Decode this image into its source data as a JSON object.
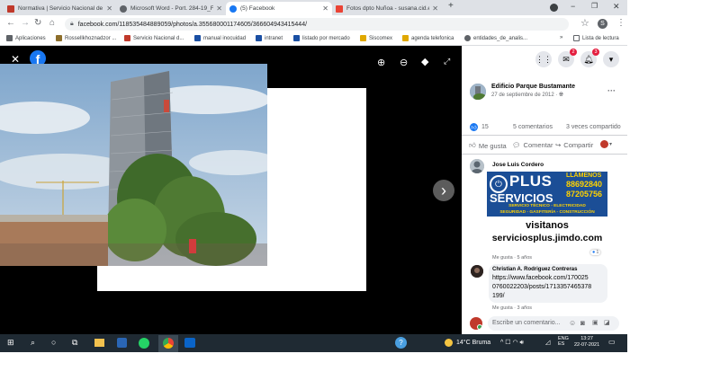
{
  "tabs": [
    {
      "title": "Normativa | Servicio Nacional de",
      "color": "#c0392b"
    },
    {
      "title": "Microsoft Word - Port. 284-19_F",
      "color": "#5f6368"
    },
    {
      "title": "(5) Facebook",
      "color": "#1877f2"
    },
    {
      "title": "Fotos dpto Ñuñoa - susana.cid.e",
      "color": "#ea4335"
    }
  ],
  "new_tab": "+",
  "window_controls": {
    "minimize": "−",
    "maximize": "❐",
    "close": "✕"
  },
  "address": {
    "url": "facebook.com/118535484889059/photos/a.355680001174605/366604943415444/"
  },
  "profile_initial": "S",
  "bookmarks": [
    {
      "label": "Aplicaciones",
      "color": "#5f6368"
    },
    {
      "label": "Rossellkhoznadzor ...",
      "color": "#8d6e2b"
    },
    {
      "label": "Servicio Nacional d...",
      "color": "#c0392b"
    },
    {
      "label": "manual inocuidad",
      "color": "#1a4fa3"
    },
    {
      "label": "intranet",
      "color": "#1a4fa3"
    },
    {
      "label": "listado por mercado",
      "color": "#1a4fa3"
    },
    {
      "label": "Siscomex",
      "color": "#e0a800"
    },
    {
      "label": "agenda telefonica",
      "color": "#e0a800"
    },
    {
      "label": "entidades_de_analis...",
      "color": "#5f6368"
    }
  ],
  "bookmarks_overflow": "»",
  "reading_list": "Lista de lectura",
  "viewer": {
    "close": "✕",
    "fb_logo": "f",
    "next": "›"
  },
  "header_badges": {
    "messenger": "2",
    "notifications": "3"
  },
  "post": {
    "author": "Edificio Parque Bustamante",
    "date": "27 de septiembre de 2012 · ",
    "more": "···",
    "reactions_count": "15",
    "comments_count": "5 comentarios",
    "shares_count": "3 veces compartido",
    "actions": {
      "like": "Me gusta",
      "comment": "Comentar",
      "share": "Compartir"
    }
  },
  "ad": {
    "brand_top": "PLUS",
    "brand_bottom": "SERVICIOS",
    "call_label": "LLÁMENOS",
    "phone1": "88692840",
    "phone2": "87205756",
    "services_line1": "SERVICIO TÉCNICO - ELECTRICIDAD",
    "services_line2": "SEGURIDAD - GASFITERÍA - CONSTRUCCIÓN",
    "visit": "visitanos",
    "site": "serviciosplus.jimdo.com"
  },
  "comments": [
    {
      "author": "Jose Luis Cordero",
      "meta": "Me gusta · 5 años",
      "reactions": "1"
    },
    {
      "author": "Christian A. Rodriguez Contreras",
      "text_lines": [
        "https://www.facebook.com/170025",
        "0760022203/posts/1713357465378",
        "199/"
      ],
      "meta": "Me gusta · 3 años"
    }
  ],
  "comment_input": {
    "placeholder": "Escribe un comentario..."
  },
  "taskbar": {
    "weather": "14°C Bruma",
    "lang": "ENG",
    "region": "ES",
    "time": "13:27",
    "date": "22-07-2021"
  }
}
